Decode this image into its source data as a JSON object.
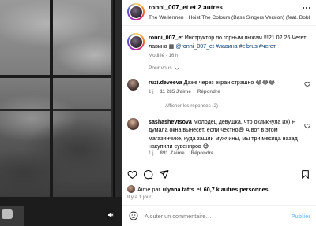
{
  "media": {
    "mute_icon": "speaker-muted-icon"
  },
  "header": {
    "username": "ronni_007_et",
    "others": "et 2 autres",
    "audio": "The Wellermen • Hoist The Colours (Bass Singers Version) (feat. Bobby B"
  },
  "caption": {
    "username": "ronni_007_et",
    "text": "Инструктор по горным лыжам !!!21.02.26 Чегет лавина",
    "mention": "@ronni_007_et",
    "tags": [
      "#лавина",
      "#elbrus",
      "#чегет"
    ],
    "edited": "Modifié",
    "time": "16 h"
  },
  "translate": {
    "label": "Pour vous"
  },
  "comments": [
    {
      "username": "ruzi.deveeva",
      "text": "Даже через экран страшно 😂😂😂",
      "time": "1 j",
      "likes": "11 285 J'aime",
      "reply": "Répondre",
      "view_replies": "Afficher les réponses (2)"
    },
    {
      "username": "sashashevtsova",
      "text": "Молодец девушка, что окликнула их) Я думала окна вынесет, если честно😅 А вот в этом магазинчике, куда зашли мужчины, мы три месяца назад накупили сувениров 😅",
      "time": "1 j",
      "likes": "891 J'aime",
      "reply": "Répondre"
    }
  ],
  "likes_line": {
    "prefix": "Aimé par",
    "user": "ulyana.tatts",
    "middle": "et",
    "count": "60,7 k autres personnes"
  },
  "time_ago": "Il y a 1 jour",
  "add_comment": {
    "placeholder": "Ajouter un commentaire…",
    "publish": "Publier"
  },
  "colors": {
    "link": "#00376b",
    "muted": "#737373",
    "publish": "#85c3f5",
    "like_red": "#ff3040"
  }
}
